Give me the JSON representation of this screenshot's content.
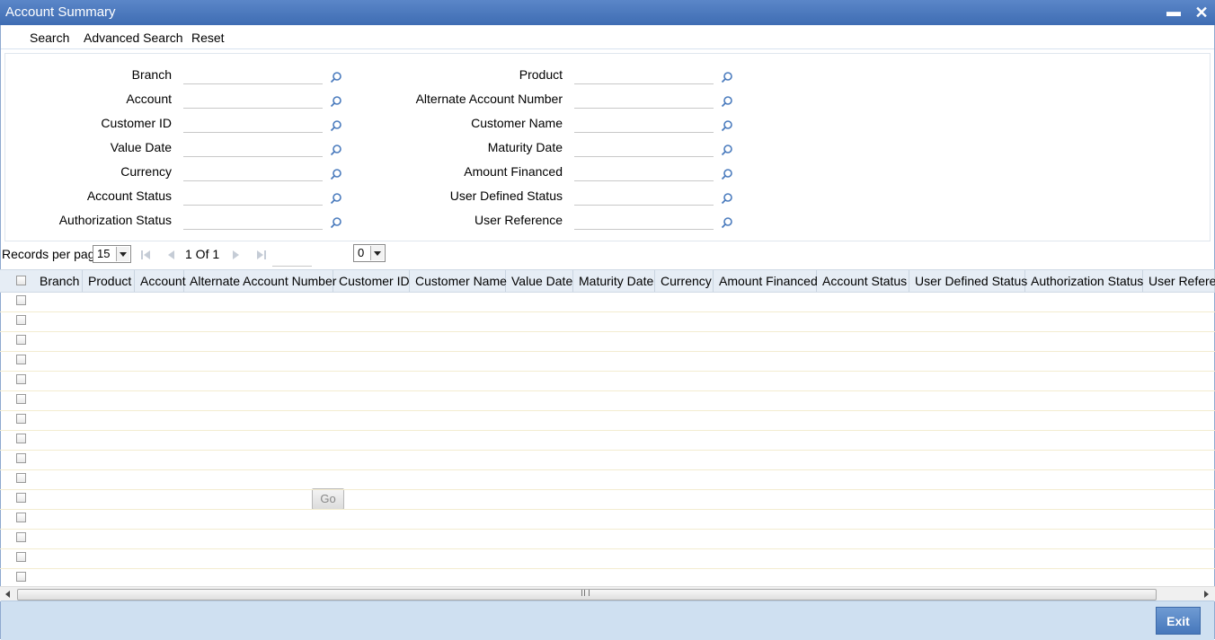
{
  "window": {
    "title": "Account Summary",
    "minimize_icon": "minimize-icon",
    "close_icon": "close-icon"
  },
  "toolbar": {
    "search": "Search",
    "advanced_search": "Advanced Search",
    "reset": "Reset"
  },
  "fields": {
    "branch": "Branch",
    "account": "Account",
    "customer_id": "Customer ID",
    "value_date": "Value Date",
    "currency": "Currency",
    "account_status": "Account Status",
    "authorization_status": "Authorization Status",
    "product": "Product",
    "alternate_account_number": "Alternate Account Number",
    "customer_name": "Customer Name",
    "maturity_date": "Maturity Date",
    "amount_financed": "Amount Financed",
    "user_defined_status": "User Defined Status",
    "user_reference": "User Reference"
  },
  "pager": {
    "records_per_page_label": "Records per page",
    "records_per_page_value": "15",
    "page_info": "1 Of 1",
    "go_label": "Go",
    "second_select_value": "0"
  },
  "grid": {
    "columns": [
      "Branch",
      "Product",
      "Account",
      "Alternate Account Number",
      "Customer ID",
      "Customer Name",
      "Value Date",
      "Maturity Date",
      "Currency",
      "Amount Financed",
      "Account Status",
      "User Defined Status",
      "Authorization Status",
      "User Refere"
    ],
    "row_count": 15
  },
  "footer": {
    "exit_label": "Exit"
  },
  "colors": {
    "title_bar": "#4a79be",
    "footer": "#cfe0f1",
    "exit_button": "#5585c4",
    "header_row": "#e6edf5"
  }
}
